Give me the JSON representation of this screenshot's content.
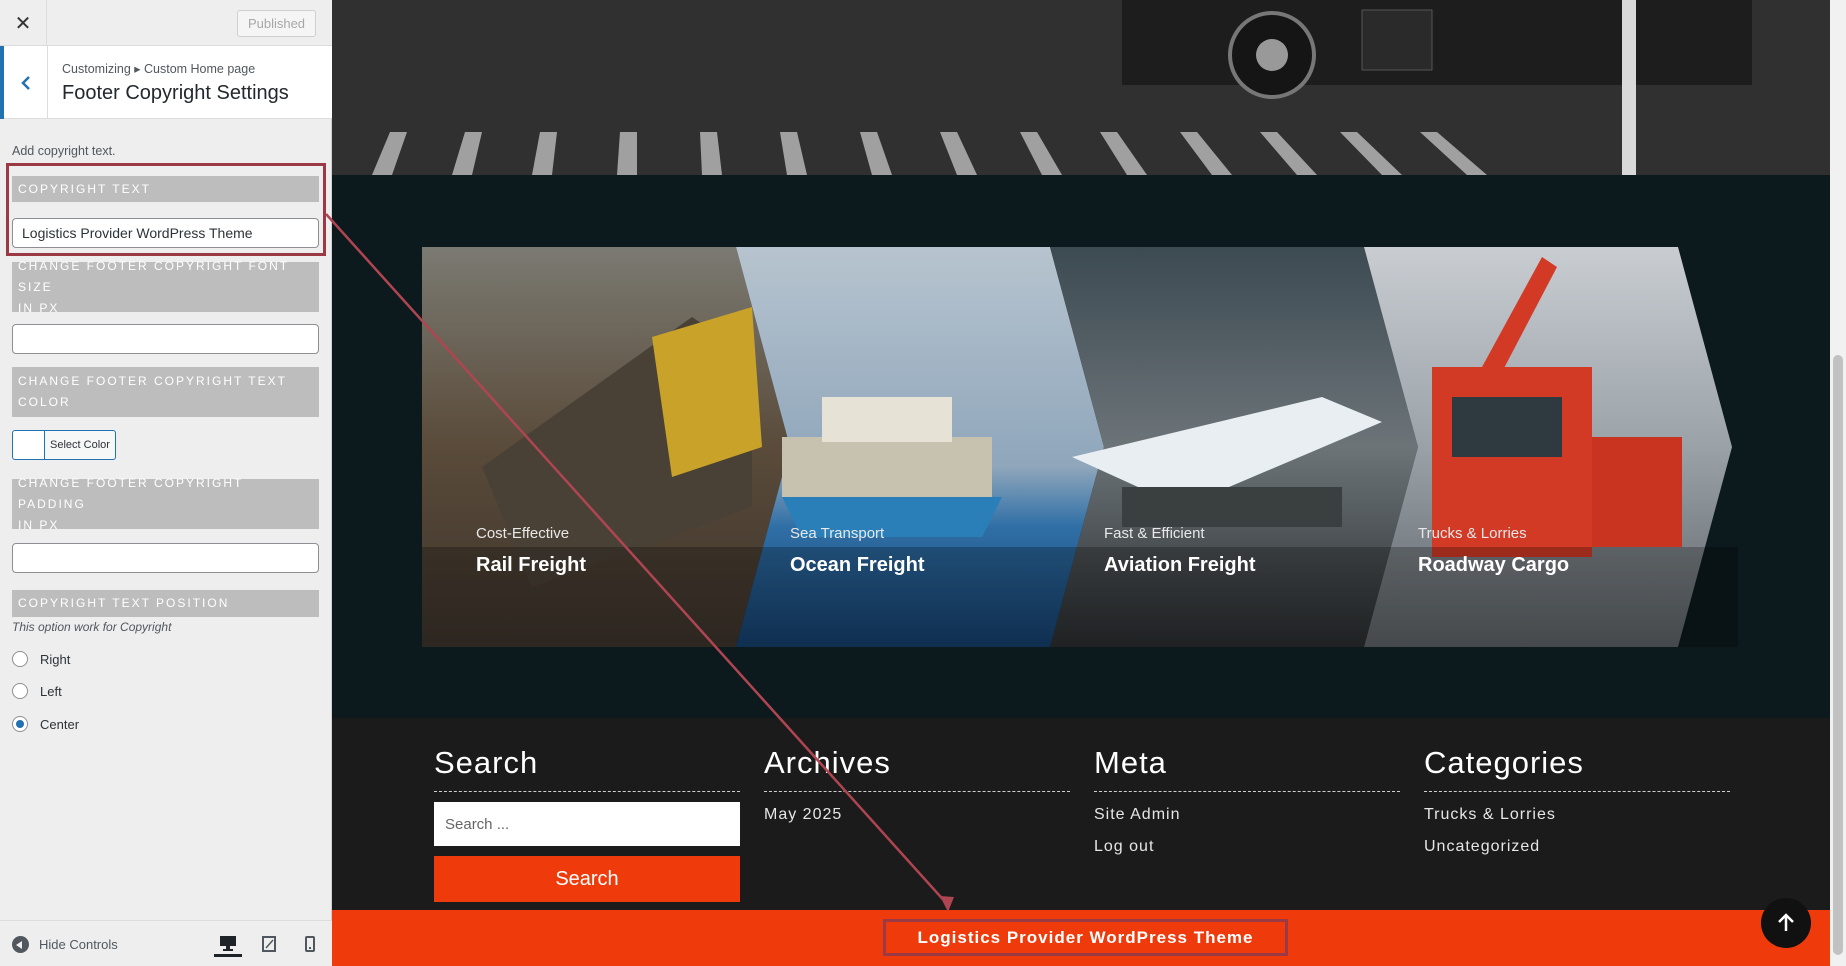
{
  "sidebar": {
    "published_label": "Published",
    "breadcrumb": "Customizing ▸ Custom Home page",
    "panel_title": "Footer Copyright Settings",
    "description": "Add copyright text.",
    "sections": {
      "copyright_text": "COPYRIGHT TEXT",
      "font_size_line1": "CHANGE FOOTER COPYRIGHT FONT SIZE",
      "font_size_line2": "IN PX",
      "text_color_line1": "CHANGE FOOTER COPYRIGHT TEXT",
      "text_color_line2": "COLOR",
      "padding_line1": "CHANGE FOOTER COPYRIGHT PADDING",
      "padding_line2": "IN PX",
      "position": "COPYRIGHT TEXT POSITION"
    },
    "copyright_value": "Logistics Provider WordPress Theme",
    "font_size_value": "",
    "padding_value": "",
    "select_color_label": "Select Color",
    "position_note": "This option work for Copyright",
    "positions": [
      {
        "label": "Right",
        "checked": false
      },
      {
        "label": "Left",
        "checked": false
      },
      {
        "label": "Center",
        "checked": true
      }
    ],
    "hide_controls_label": "Hide Controls"
  },
  "preview": {
    "services": [
      {
        "subtitle": "Cost-Effective",
        "name": "Rail Freight"
      },
      {
        "subtitle": "Sea Transport",
        "name": "Ocean Freight"
      },
      {
        "subtitle": "Fast & Efficient",
        "name": "Aviation Freight"
      },
      {
        "subtitle": "Trucks & Lorries",
        "name": "Roadway Cargo"
      }
    ],
    "footer": {
      "search_title": "Search",
      "search_placeholder": "Search ...",
      "search_button": "Search",
      "archives_title": "Archives",
      "archives": [
        "May 2025"
      ],
      "meta_title": "Meta",
      "meta": [
        "Site Admin",
        "Log out"
      ],
      "categories_title": "Categories",
      "categories": [
        "Trucks & Lorries",
        "Uncategorized"
      ]
    },
    "copyright": "Logistics Provider WordPress Theme"
  },
  "colors": {
    "accent": "#ef3b0c",
    "highlight": "#9b3a45",
    "wp_blue": "#2271b1"
  }
}
